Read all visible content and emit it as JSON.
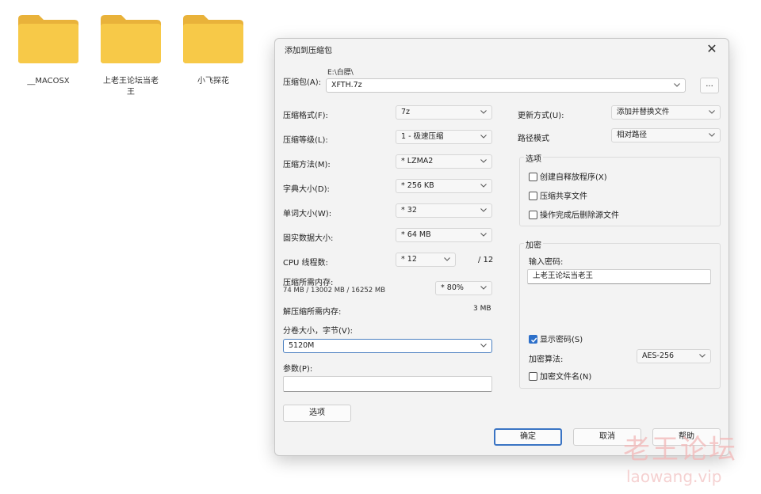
{
  "desktop": {
    "folders": [
      {
        "label": "__MACOSX"
      },
      {
        "label": "上老王论坛当老王"
      },
      {
        "label": "小飞探花"
      }
    ]
  },
  "dialog": {
    "title": "添加到压缩包",
    "close_glyph": "✕",
    "archive": {
      "label": "压缩包(A):",
      "path": "E:\\白膘\\",
      "value": "XFTH.7z",
      "browse_label": "..."
    },
    "left": {
      "format": {
        "label": "压缩格式(F):",
        "value": "7z"
      },
      "level": {
        "label": "压缩等级(L):",
        "value": "1 - 极速压缩"
      },
      "method": {
        "label": "压缩方法(M):",
        "value": "* LZMA2"
      },
      "dict": {
        "label": "字典大小(D):",
        "value": "* 256 KB"
      },
      "word": {
        "label": "单词大小(W):",
        "value": "* 32"
      },
      "solid": {
        "label": "固实数据大小:",
        "value": "* 64 MB"
      },
      "cpu": {
        "label": "CPU 线程数:",
        "value": "* 12",
        "max": "/ 12"
      },
      "mem_compress": {
        "label": "压缩所需内存:",
        "detail": "74 MB / 13002 MB / 16252 MB",
        "value": "* 80%"
      },
      "mem_decompress": {
        "label": "解压缩所需内存:",
        "value": "3 MB"
      },
      "split": {
        "label": "分卷大小，字节(V):",
        "value": "5120M"
      },
      "params": {
        "label": "参数(P):",
        "value": ""
      },
      "options_button": "选项"
    },
    "right": {
      "update": {
        "label": "更新方式(U):",
        "value": "添加并替换文件"
      },
      "path_mode": {
        "label": "路径模式",
        "value": "相对路径"
      },
      "options_group": {
        "title": "选项",
        "checks": [
          {
            "label": "创建自释放程序(X)",
            "checked": false
          },
          {
            "label": "压缩共享文件",
            "checked": false
          },
          {
            "label": "操作完成后删除源文件",
            "checked": false
          }
        ]
      },
      "encrypt_group": {
        "title": "加密",
        "password_label": "输入密码:",
        "password_value": "上老王论坛当老王",
        "show_password": {
          "label": "显示密码(S)",
          "checked": true
        },
        "method_label": "加密算法:",
        "method_value": "AES-256",
        "encrypt_names": {
          "label": "加密文件名(N)",
          "checked": false
        }
      }
    },
    "buttons": {
      "ok": "确定",
      "cancel": "取消",
      "help": "帮助"
    }
  },
  "watermark": {
    "line1": "老王论坛",
    "line2": "laowang.vip"
  },
  "colors": {
    "folder": "#f7c948",
    "folder_dark": "#e9b23a",
    "accent": "#2c6fc9",
    "watermark": "#f2b8b8"
  }
}
